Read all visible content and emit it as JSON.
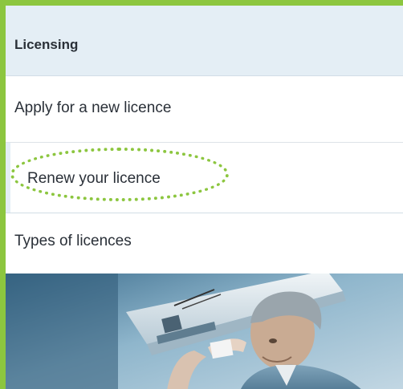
{
  "nav": {
    "header": "Licensing",
    "items": [
      {
        "label": "Apply for a new licence"
      },
      {
        "label": "Renew your licence"
      },
      {
        "label": "Types of licences"
      }
    ]
  },
  "hero": {
    "image": "technician-repairing-air-conditioner-photo"
  },
  "colors": {
    "frame_border": "#8cc63f",
    "highlight_ring": "#8cc63f",
    "header_bg": "#e4eef5",
    "text": "#2a3038"
  }
}
